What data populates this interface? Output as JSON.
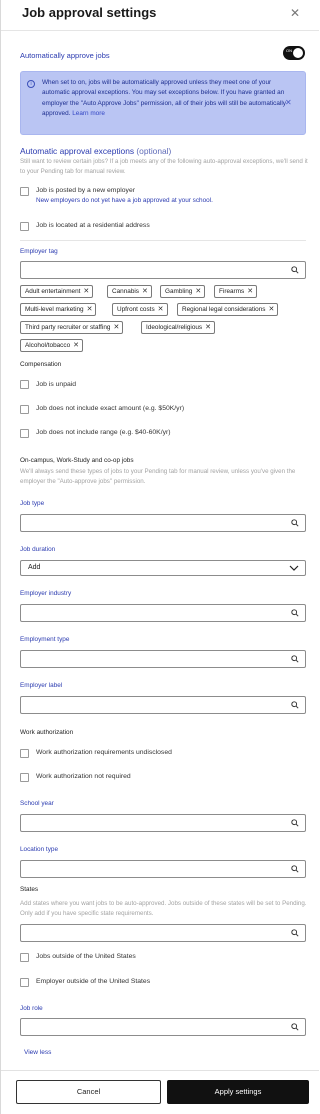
{
  "header": {
    "title": "Job approval settings"
  },
  "auto_approve": {
    "label": "Automatically approve jobs",
    "toggle_text": "ON",
    "toggle_on": true
  },
  "info_banner": {
    "text": "When set to on, jobs will be automatically approved unless they meet one of your automatic approval exceptions. You may set exceptions below. If you have granted an employer the \"Auto Approve Jobs\" permission, all of their jobs will still be automatically approved.",
    "link": "Learn more"
  },
  "exceptions": {
    "title": "Automatic approval exceptions",
    "optional": "(optional)",
    "subtitle": "Still want to review certain jobs? If a job meets any of the following auto-approval exceptions, we'll send it to your Pending tab for manual review.",
    "new_employer_label": "Job is posted by a new employer",
    "new_employer_sub": "New employers do not yet have a job approved at your school.",
    "residential_label": "Job is located at a residential address"
  },
  "employer_tag": {
    "label": "Employer tag",
    "chips": [
      "Adult entertainment",
      "Cannabis",
      "Gambling",
      "Firearms",
      "Multi-level marketing",
      "Upfront costs",
      "Regional legal considerations",
      "Third party recruiter or staffing",
      "Ideological/religious",
      "Alcohol/tobacco"
    ]
  },
  "compensation": {
    "title": "Compensation",
    "unpaid": "Job is unpaid",
    "no_amount": "Job does not include exact amount (e.g. $50K/yr)",
    "no_range": "Job does not include range (e.g. $40-60K/yr)"
  },
  "oncampus": {
    "title": "On-campus, Work-Study and co-op jobs",
    "subtitle": "We'll always send these types of jobs to your Pending tab for manual review, unless you've given the employer the \"Auto-approve jobs\" permission."
  },
  "fields": {
    "job_type": "Job type",
    "job_duration": "Job duration",
    "job_duration_value": "Add",
    "employer_industry": "Employer industry",
    "employment_type": "Employment type",
    "employer_label": "Employer label",
    "school_year": "School year",
    "location_type": "Location type",
    "job_role": "Job role"
  },
  "work_auth": {
    "title": "Work authorization",
    "undisclosed": "Work authorization requirements undisclosed",
    "not_required": "Work authorization not required"
  },
  "states": {
    "title": "States",
    "subtitle": "Add states where you want jobs to be auto-approved. Jobs outside of these states will be set to Pending. Only add if you have specific state requirements.",
    "outside_us": "Jobs outside of the United States",
    "employer_outside_us": "Employer outside of the United States"
  },
  "view_less": "View less",
  "footer": {
    "cancel": "Cancel",
    "apply": "Apply settings"
  },
  "colors": {
    "accent": "#2b3bb0",
    "banner": "#bac5f3",
    "primary_button": "#111111"
  },
  "icons": {
    "close": "close-icon",
    "info": "info-icon",
    "search": "search-icon",
    "chevron": "chevron-down-icon"
  }
}
